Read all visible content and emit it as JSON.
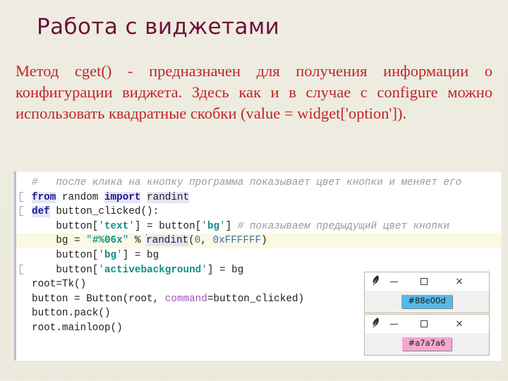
{
  "slide": {
    "title": "Работа с виджетами",
    "body_text": "Метод cget() - предназначен для получения информации о конфигурации виджета. Здесь как и в случае с configure можно использовать квадратные скобки (value = widget['option'])."
  },
  "code": {
    "language": "python",
    "lines": [
      {
        "id": "line-comment-top",
        "tokens": [
          {
            "text": "#   после клика на кнопку программа показывает цвет кнопки и меняет его",
            "type": "comment"
          }
        ]
      },
      {
        "id": "line-import",
        "fold": true,
        "tokens": [
          {
            "text": "from",
            "type": "kw2"
          },
          {
            "text": " random ",
            "type": "plain"
          },
          {
            "text": "import",
            "type": "kw2"
          },
          {
            "text": " ",
            "type": "plain"
          },
          {
            "text": "randint",
            "type": "name-hl"
          }
        ]
      },
      {
        "id": "line-def",
        "fold": true,
        "tokens": [
          {
            "text": "def",
            "type": "kw2"
          },
          {
            "text": " button_clicked():",
            "type": "plain"
          }
        ]
      },
      {
        "id": "line-text-assign",
        "tokens": [
          {
            "text": "    button[",
            "type": "plain"
          },
          {
            "text": "'",
            "type": "strq"
          },
          {
            "text": "text",
            "type": "str"
          },
          {
            "text": "'",
            "type": "strq"
          },
          {
            "text": "] = button[",
            "type": "plain"
          },
          {
            "text": "'",
            "type": "strq"
          },
          {
            "text": "bg",
            "type": "str"
          },
          {
            "text": "'",
            "type": "strq"
          },
          {
            "text": "] ",
            "type": "plain"
          },
          {
            "text": "# показываем предыдущий цвет кнопки",
            "type": "comment"
          }
        ]
      },
      {
        "id": "line-bg-random",
        "highlight": true,
        "tokens": [
          {
            "text": "    bg = ",
            "type": "plain"
          },
          {
            "text": "\"",
            "type": "strq"
          },
          {
            "text": "#%06x",
            "type": "str"
          },
          {
            "text": "\"",
            "type": "strq"
          },
          {
            "text": " % ",
            "type": "plain"
          },
          {
            "text": "",
            "type": "caret"
          },
          {
            "text": "randint",
            "type": "name-hl"
          },
          {
            "text": "(",
            "type": "plain"
          },
          {
            "text": "0",
            "type": "num"
          },
          {
            "text": ", ",
            "type": "plain"
          },
          {
            "text": "0xFFFFFF",
            "type": "num"
          },
          {
            "text": ")",
            "type": "plain"
          }
        ]
      },
      {
        "id": "line-bg-assign",
        "tokens": [
          {
            "text": "    button[",
            "type": "plain"
          },
          {
            "text": "'",
            "type": "strq"
          },
          {
            "text": "bg",
            "type": "str"
          },
          {
            "text": "'",
            "type": "strq"
          },
          {
            "text": "] = bg",
            "type": "plain"
          }
        ]
      },
      {
        "id": "line-activebackground",
        "fold": true,
        "tokens": [
          {
            "text": "    button[",
            "type": "plain"
          },
          {
            "text": "'",
            "type": "strq"
          },
          {
            "text": "activebackground",
            "type": "str"
          },
          {
            "text": "'",
            "type": "strq"
          },
          {
            "text": "] = bg",
            "type": "plain"
          }
        ]
      },
      {
        "id": "line-root-tk",
        "tokens": [
          {
            "text": "root=Tk()",
            "type": "plain"
          }
        ]
      },
      {
        "id": "line-button-ctor",
        "tokens": [
          {
            "text": "button = Button(root, ",
            "type": "plain"
          },
          {
            "text": "command",
            "type": "param"
          },
          {
            "text": "=button_clicked)",
            "type": "plain"
          }
        ]
      },
      {
        "id": "line-button-pack",
        "tokens": [
          {
            "text": "button.pack()",
            "type": "plain"
          }
        ]
      },
      {
        "id": "line-mainloop",
        "tokens": [
          {
            "text": "root.mainloop()",
            "type": "plain"
          }
        ]
      }
    ]
  },
  "tk_windows": [
    {
      "id": "tk-window-1",
      "icon": "feather-icon",
      "minimize_label": "minimize",
      "maximize_label": "maximize",
      "close_label": "×",
      "button_label": "#88e00d",
      "button_bg": "#56b9e8",
      "button_fg": "#1b1b1b"
    },
    {
      "id": "tk-window-2",
      "icon": "feather-icon",
      "minimize_label": "minimize",
      "maximize_label": "maximize",
      "close_label": "×",
      "button_label": "#a7a7a6",
      "button_bg": "#f4a9d0",
      "button_fg": "#1b1b1b"
    }
  ],
  "colors": {
    "slide_background": "#eae7d4",
    "title_text": "#6d1139",
    "body_text": "#c0252a",
    "code_background": "#ffffff",
    "code_border": "#b8bcd0",
    "current_line_highlight": "#fbf8e3"
  }
}
